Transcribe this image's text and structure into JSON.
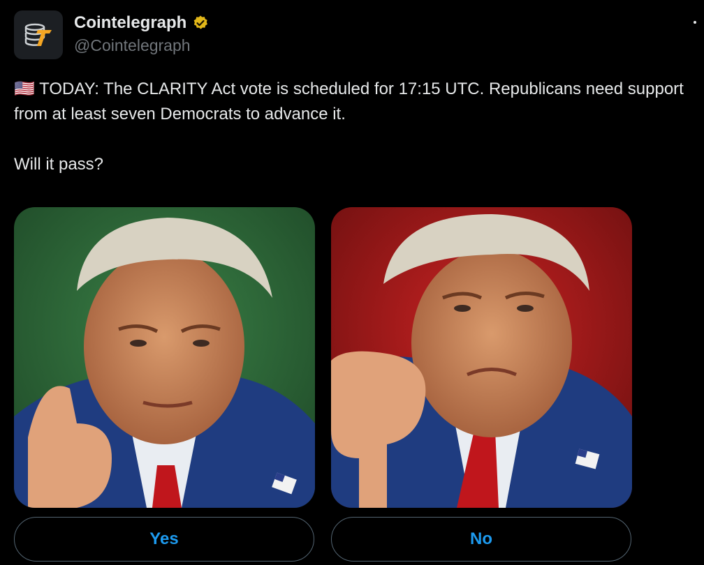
{
  "author": {
    "display_name": "Cointelegraph",
    "handle": "@Cointelegraph",
    "verified": true,
    "avatar_icon": "cointelegraph-logo-icon",
    "verified_icon": "gold-verified-badge-icon"
  },
  "tweet": {
    "text": "🇺🇸 TODAY: The CLARITY Act vote is scheduled for 17:15 UTC. Republicans need support from at least seven Democrats to advance it.\n\nWill it pass?"
  },
  "poll": {
    "options": [
      {
        "label": "Yes",
        "image_icon": "thumbs-up-portrait-image",
        "background": "#2f6b3a"
      },
      {
        "label": "No",
        "image_icon": "thumbs-down-portrait-image",
        "background": "#a81e1e"
      }
    ]
  },
  "colors": {
    "background": "#000000",
    "text": "#e7e9ea",
    "secondary_text": "#71767b",
    "accent": "#1d9bf0",
    "verified_gold": "#e2b719"
  }
}
